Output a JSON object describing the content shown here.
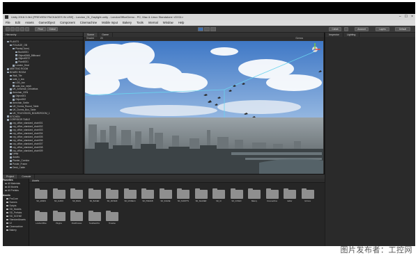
{
  "window": {
    "title": "Unity 2018.3.0b1 [PREVIEW PACKAGES IN USE] - London_01_Daylight.unity - LondonOfficeDemo - PC, Mac & Linux Standalone <DX11>",
    "controls": [
      "–",
      "☐",
      "×"
    ]
  },
  "menu": [
    "File",
    "Edit",
    "Assets",
    "GameObject",
    "Component",
    "Cinemachine",
    "Mobile Input",
    "Bakery",
    "Tools",
    "Internal",
    "Window",
    "Help"
  ],
  "toolbar": {
    "pivot": "Pivot",
    "global": "Global",
    "collab": "Collab",
    "account": "Account",
    "layers": "Layers",
    "layout": "Default"
  },
  "hierarchy": {
    "tab": "Hierarchy",
    "rows": [
      {
        "text": "PLANTS",
        "indent": 1,
        "sel": false
      },
      {
        "text": "FOLIAGE_OB",
        "indent": 2,
        "sel": false
      },
      {
        "text": "Plants(Clone)",
        "indent": 3,
        "sel": false
      },
      {
        "text": "Bush0001",
        "indent": 4,
        "sel": false
      },
      {
        "text": "Object0065_Billboard",
        "indent": 4,
        "sel": false
      },
      {
        "text": "Object0072",
        "indent": 4,
        "sel": false
      },
      {
        "text": "Plant0001",
        "indent": 4,
        "sel": false
      },
      {
        "text": "London_Deal",
        "indent": 3,
        "sel": false
      },
      {
        "text": "MEETING ROOM",
        "indent": 1,
        "sel": false
      },
      {
        "text": "BOARD ROOM",
        "indent": 1,
        "sel": false
      },
      {
        "text": "Wall_Tile",
        "indent": 2,
        "sel": false
      },
      {
        "text": "sofa_1_low",
        "indent": 2,
        "sel": false
      },
      {
        "text": "LOD_low",
        "indent": 3,
        "sel": false
      },
      {
        "text": "sofa_low_mesh",
        "indent": 3,
        "sel": false
      },
      {
        "text": "UK_Armchair_Grindelwa",
        "indent": 2,
        "sel": false
      },
      {
        "text": "Armchair_GEN",
        "indent": 2,
        "sel": false
      },
      {
        "text": "Object001",
        "indent": 3,
        "sel": false
      },
      {
        "text": "Object002",
        "indent": 3,
        "sel": false
      },
      {
        "text": "Armchair_Settle",
        "indent": 2,
        "sel": false
      },
      {
        "text": "UK_Dorms_Round_Table",
        "indent": 2,
        "sel": false
      },
      {
        "text": "UK_Dorms_Bus_Table",
        "indent": 2,
        "sel": false
      },
      {
        "text": "UK_TELEVISION_BOARDROOM_1",
        "indent": 2,
        "sel": false
      },
      {
        "text": "KITCHEN",
        "indent": 1,
        "sel": false
      },
      {
        "text": "CORRIDOR TABLE",
        "indent": 1,
        "sel": false
      },
      {
        "text": "crp_office_standard_chair001",
        "indent": 2,
        "sel": false
      },
      {
        "text": "crp_office_standard_chair002",
        "indent": 2,
        "sel": false
      },
      {
        "text": "crp_office_standard_chair003",
        "indent": 2,
        "sel": false
      },
      {
        "text": "crp_office_standard_chair004",
        "indent": 2,
        "sel": false
      },
      {
        "text": "crp_office_standard_chair005",
        "indent": 2,
        "sel": false
      },
      {
        "text": "crp_office_standard_chair006",
        "indent": 2,
        "sel": false
      },
      {
        "text": "crp_office_standard_chair007",
        "indent": 2,
        "sel": false
      },
      {
        "text": "crp_office_standard_chair008",
        "indent": 2,
        "sel": false
      },
      {
        "text": "crp_office_standard_chair009",
        "indent": 2,
        "sel": false
      },
      {
        "text": "Lamp",
        "indent": 2,
        "sel": false
      },
      {
        "text": "Assets",
        "indent": 2,
        "sel": false
      },
      {
        "text": "Planter_Corridor",
        "indent": 2,
        "sel": false
      },
      {
        "text": "Poster_Frame",
        "indent": 2,
        "sel": false
      },
      {
        "text": "Desk_Cable",
        "indent": 2,
        "sel": false
      }
    ]
  },
  "scene": {
    "tabs": [
      "Scene",
      "Game"
    ],
    "shading": "Shaded",
    "mode": "2D",
    "gizmos": "Gizmos"
  },
  "inspector": {
    "tabs": [
      "Inspector",
      "Lighting"
    ]
  },
  "project": {
    "tabs": [
      "Project",
      "Console"
    ],
    "favorites_header": "Favorites",
    "favorites": [
      "All Materials",
      "All Models",
      "All Prefabs"
    ],
    "assets_header": "Assets",
    "asset_folders": [
      "ProCore",
      "Scenes",
      "Scripts",
      "SD_Models",
      "SD_Prefabs",
      "SD_SCENE",
      "StandardAssets",
      "UI",
      "Cinemachine",
      "Bakery"
    ],
    "breadcrumb": "Assets",
    "tiles": [
      "SD_ADMIN",
      "SD_AUDIO",
      "SD_BAKE",
      "SD_BAKER",
      "SD_MATERI",
      "SD_MODELS",
      "SD_PREFAB",
      "SD_SCENE",
      "SD_SCRIPTS",
      "SD_SHADER",
      "SD_UI",
      "SD_CONEX",
      "Bakery",
      "Cinemachine",
      "Editor",
      "Gizmos",
      "LondonOffice",
      "Plugins",
      "PostProcess",
      "TextMeshPro",
      "Timeline"
    ]
  },
  "watermark": "图片发布者：工控网"
}
